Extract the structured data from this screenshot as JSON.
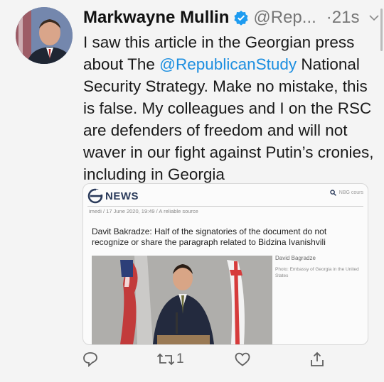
{
  "tweet": {
    "author_name": "Markwayne Mullin",
    "handle": "@Rep...",
    "time": "·21s",
    "text_before": "I saw this article in the Georgian press about The ",
    "mention": "@RepublicanStudy",
    "text_after": " National Security Strategy. Make no mistake, this is false. My colleagues and I on the RSC are defenders of freedom and will not waver in our fight against Putin’s cronies, including in Georgia"
  },
  "card": {
    "logo_text": "NEWS",
    "search_placeholder": "NBG cours",
    "meta": "imedi / 17 June 2020, 19:49 / A reliable source",
    "headline": "Davit Bakradze: Half of the signatories of the document do not recognize or share the paragraph related to Bidzina Ivanishvili",
    "caption_author": "David Bagradze",
    "caption_credit": "Photo: Embassy of Georgia in the United States"
  },
  "actions": {
    "retweet_count": "1"
  },
  "icons": {
    "verified": "verified-badge-icon",
    "chevron": "chevron-down-icon",
    "reply": "reply-icon",
    "retweet": "retweet-icon",
    "like": "heart-icon",
    "share": "share-icon",
    "search": "search-icon"
  },
  "colors": {
    "accent": "#1d8fe0",
    "text": "#1a1a1a",
    "muted": "#777777"
  }
}
